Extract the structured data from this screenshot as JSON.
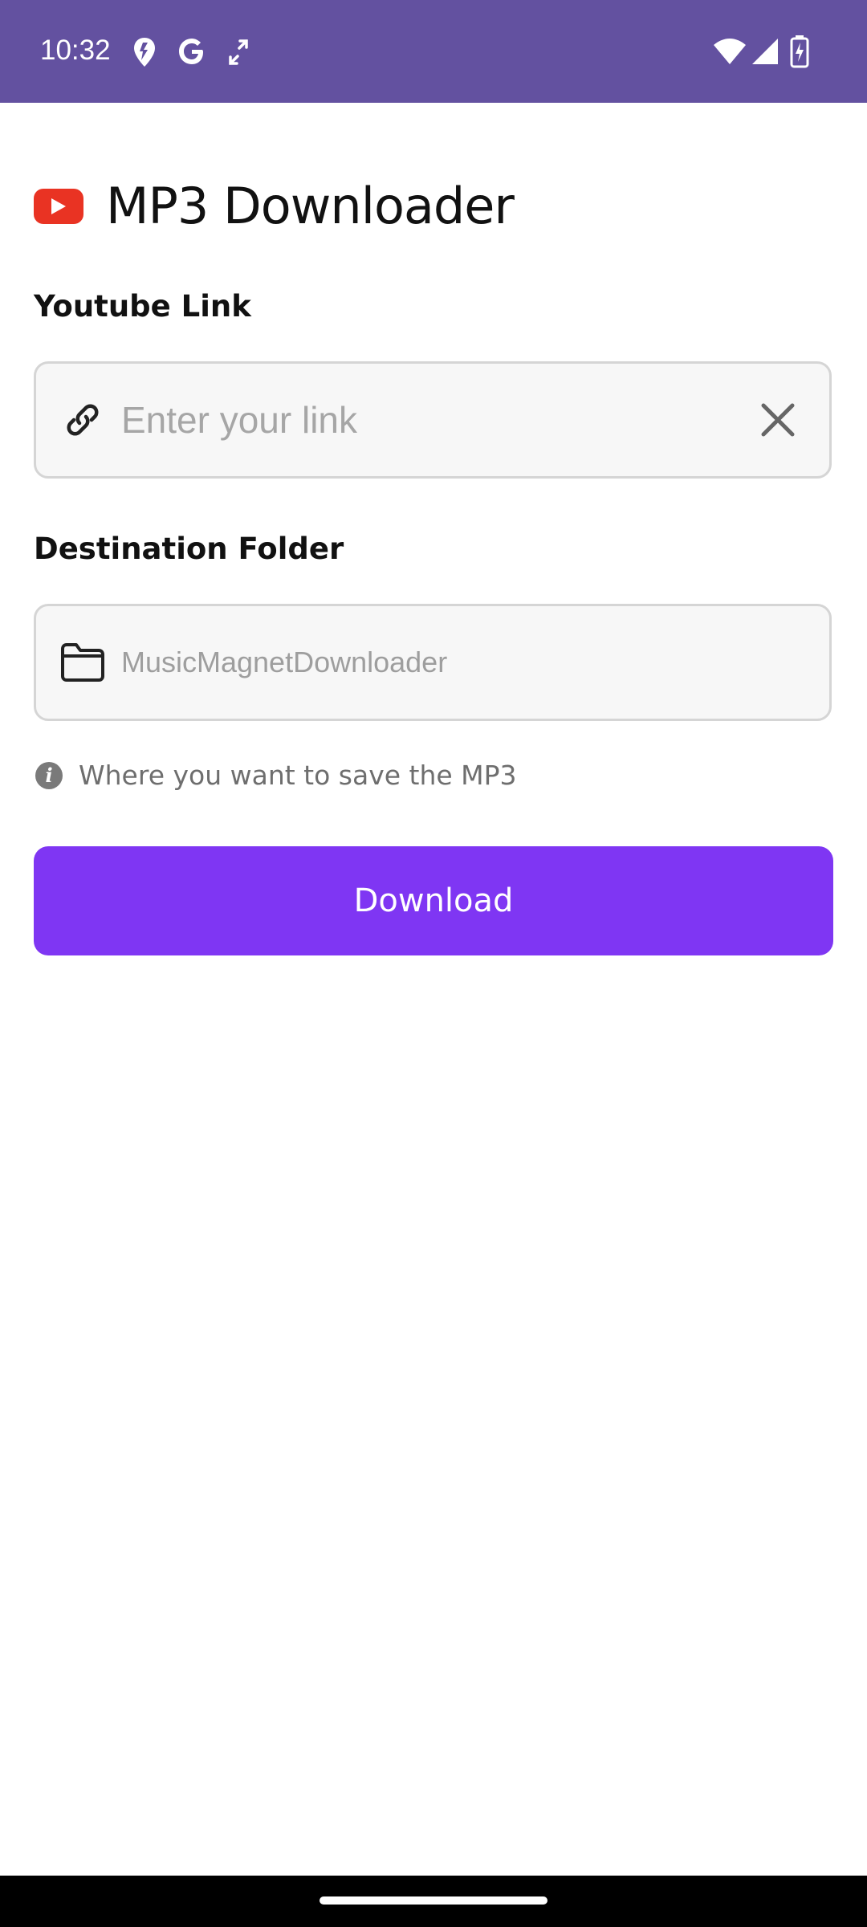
{
  "status_bar": {
    "time": "10:32",
    "background": "#6351a0",
    "left_icons": [
      "location-icon",
      "google-icon",
      "sync-icon"
    ],
    "right_icons": [
      "wifi-icon",
      "signal-icon",
      "battery-charging-icon"
    ]
  },
  "header": {
    "logo": "youtube-logo",
    "title": "MP3 Downloader"
  },
  "youtube_link": {
    "label": "Youtube Link",
    "placeholder": "Enter your link",
    "value": "",
    "left_icon": "link-icon",
    "clear_icon": "close-icon"
  },
  "destination": {
    "label": "Destination Folder",
    "value": "MusicMagnetDownloader",
    "icon": "folder-icon",
    "hint": "Where you want to save the MP3",
    "hint_icon": "info-icon"
  },
  "download_button": {
    "label": "Download",
    "color": "#7f36f3"
  }
}
